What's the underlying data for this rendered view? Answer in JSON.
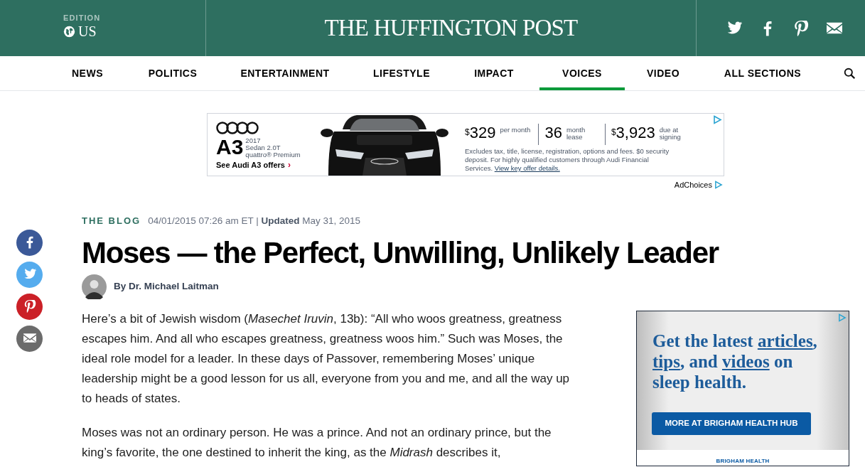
{
  "header": {
    "edition_label": "EDITION",
    "edition": "US",
    "logo": "THE HUFFINGTON POST",
    "social": [
      {
        "kind": "twitter"
      },
      {
        "kind": "facebook"
      },
      {
        "kind": "pinterest"
      },
      {
        "kind": "email"
      }
    ]
  },
  "nav": [
    {
      "label": "NEWS",
      "selected": false
    },
    {
      "label": "POLITICS",
      "selected": false
    },
    {
      "label": "ENTERTAINMENT",
      "selected": false
    },
    {
      "label": "LIFESTYLE",
      "selected": false
    },
    {
      "label": "IMPACT",
      "selected": false
    },
    {
      "label": "VOICES",
      "selected": true
    },
    {
      "label": "VIDEO",
      "selected": false
    },
    {
      "label": "ALL SECTIONS",
      "selected": false
    }
  ],
  "top_ad": {
    "model": "A3",
    "year": "2017",
    "trim": "Sedan 2.0T",
    "package": "quattro® Premium",
    "cta": "See Audi A3 offers",
    "cta_arrow": "›",
    "offers": [
      {
        "currency": "$",
        "amount": "329",
        "unit": "per month"
      },
      {
        "amount": "36",
        "unit": "month lease"
      },
      {
        "currency": "$",
        "amount": "3,923",
        "unit": "due at signing"
      }
    ],
    "disclaimer": "Excludes tax, title, license, registration, options and fees. $0 security deposit. For highly qualified customers through Audi Financial Services.",
    "disclaimer_link": "View key offer details.",
    "ad_choices": "AdChoices"
  },
  "share": [
    {
      "kind": "facebook"
    },
    {
      "kind": "twitter"
    },
    {
      "kind": "pinterest"
    },
    {
      "kind": "email"
    }
  ],
  "article": {
    "section": "THE BLOG",
    "published": "04/01/2015 07:26 am ET |",
    "updated_label": "Updated",
    "updated": "May 31, 2015",
    "title": "Moses — the Perfect, Unwilling, Unlikely Leader",
    "byline": "By Dr. Michael Laitman",
    "paragraphs": [
      "Here’s a bit of Jewish wisdom (*Masechet Iruvin*, 13b): “All who woos greatness, greatness escapes him. And all who escapes greatness, greatness woos him.” Such was Moses, the ideal role model for a leader. In these days of Passover, remembering Moses’ unique leadership might be a good lesson for us all, everyone from you and me, and all the way up to heads of states.",
      "Moses was not an ordinary person. He was a prince. And not an ordinary prince, but the king’s favorite, the one destined to inherit the king, as the *Midrash* describes it,"
    ]
  },
  "side_ad": {
    "headline": [
      {
        "text": "Get the latest ",
        "link": false
      },
      {
        "text": "articles",
        "link": true
      },
      {
        "text": ", ",
        "link": false
      },
      {
        "text": "tips",
        "link": true
      },
      {
        "text": ", and ",
        "link": false
      },
      {
        "text": "videos",
        "link": true
      },
      {
        "text": " on sleep health.",
        "link": false
      }
    ],
    "button": "MORE AT BRIGHAM HEALTH HUB",
    "footer": "BRIGHAM HEALTH"
  }
}
